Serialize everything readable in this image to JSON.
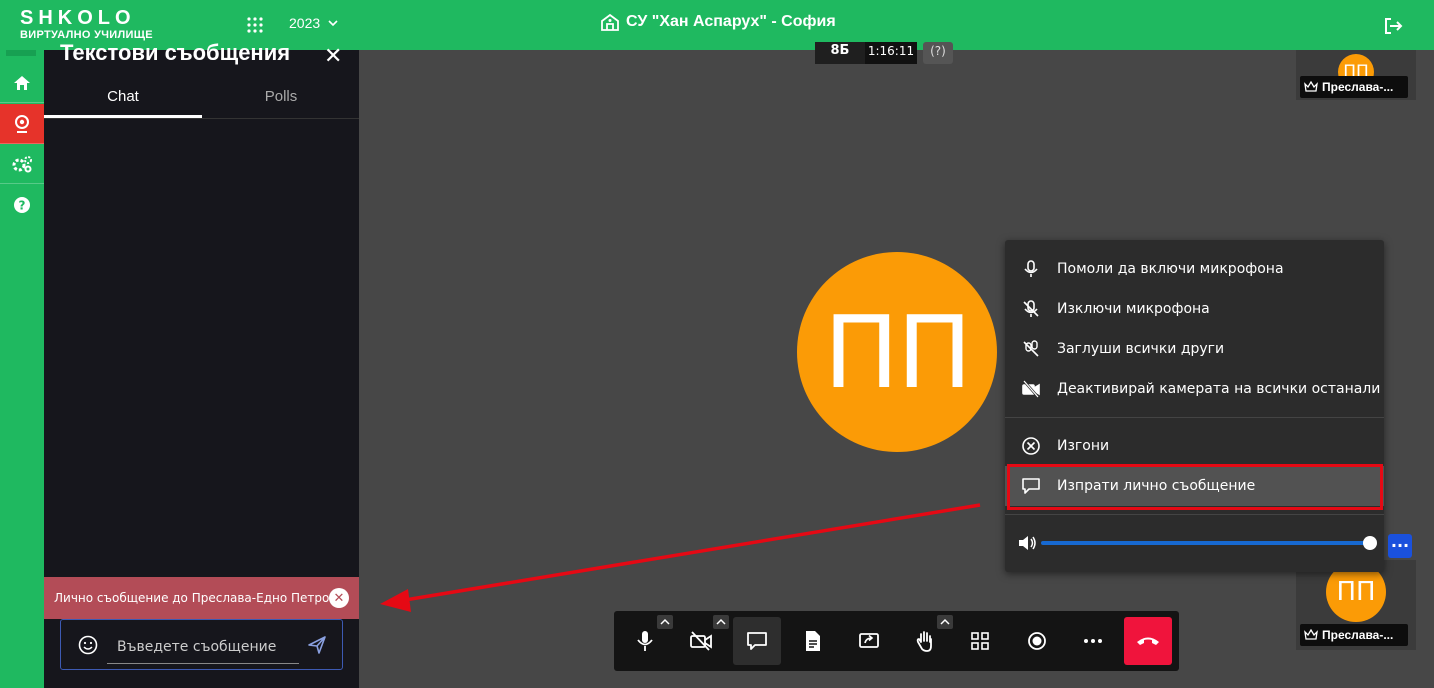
{
  "brand": {
    "name": "SHKOLO",
    "tagline": "ВИРТУАЛНО УЧИЛИЩЕ"
  },
  "header": {
    "year": "2023",
    "school": "СУ \"Хан Аспарух\" - София"
  },
  "rail": {
    "items": [
      "home",
      "webinar",
      "settings",
      "help"
    ]
  },
  "chat": {
    "title": "Текстови съобщения",
    "tabs": [
      "Chat",
      "Polls"
    ],
    "private_banner": "Лично съобщение до Преслава-Едно Петрова",
    "input_placeholder": "Въведете съобщение"
  },
  "meeting": {
    "class_label": "8Б",
    "elapsed": "1:16:11",
    "help_label": "(?)",
    "avatar_initials": "ПП",
    "participant_name": "Преслава-..."
  },
  "context_menu": {
    "items": [
      {
        "label": "Помоли да включи микрофона",
        "icon": "mic-icon"
      },
      {
        "label": "Изключи микрофона",
        "icon": "mic-off-icon"
      },
      {
        "label": "Заглуши всички други",
        "icon": "mute-all-icon"
      },
      {
        "label": "Деактивирай камерата на всички останали",
        "icon": "camera-off-icon"
      },
      {
        "label": "Изгони",
        "icon": "kick-icon"
      },
      {
        "label": "Изпрати лично съобщение",
        "icon": "private-message-icon"
      }
    ],
    "volume": 1.0
  },
  "toolbar": {
    "buttons": [
      "microphone",
      "camera",
      "chat",
      "document",
      "share-screen",
      "raise-hand",
      "tile-view",
      "record",
      "more",
      "hang-up"
    ]
  },
  "colors": {
    "brand_green": "#1fb960",
    "accent_red": "#e6332a",
    "avatar_orange": "#fb9b06",
    "hangup_red": "#f0143c",
    "volume_blue": "#1769d1"
  }
}
